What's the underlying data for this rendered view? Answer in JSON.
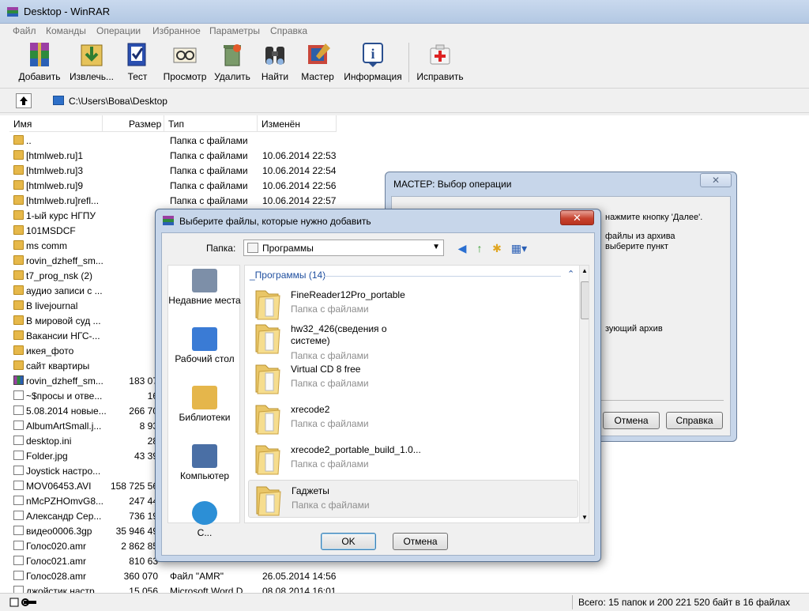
{
  "window": {
    "title": "Desktop - WinRAR"
  },
  "menu": [
    "Файл",
    "Команды",
    "Операции",
    "Избранное",
    "Параметры",
    "Справка"
  ],
  "toolbar": [
    {
      "label": "Добавить",
      "icon": "add-archive-icon"
    },
    {
      "label": "Извлечь...",
      "icon": "extract-icon"
    },
    {
      "label": "Тест",
      "icon": "test-icon"
    },
    {
      "label": "Просмотр",
      "icon": "view-icon"
    },
    {
      "label": "Удалить",
      "icon": "delete-icon"
    },
    {
      "label": "Найти",
      "icon": "find-icon"
    },
    {
      "label": "Мастер",
      "icon": "wizard-icon"
    },
    {
      "label": "Информация",
      "icon": "info-icon"
    },
    {
      "label": "Исправить",
      "icon": "repair-icon"
    }
  ],
  "address": {
    "path": "C:\\Users\\Вова\\Desktop"
  },
  "columns": {
    "name": "Имя",
    "size": "Размер",
    "type": "Тип",
    "modified": "Изменён"
  },
  "files": [
    {
      "name": "..",
      "size": "",
      "type": "Папка с файлами",
      "date": "",
      "kind": "folder"
    },
    {
      "name": "[htmlweb.ru]1",
      "size": "",
      "type": "Папка с файлами",
      "date": "10.06.2014 22:53",
      "kind": "folder"
    },
    {
      "name": "[htmlweb.ru]3",
      "size": "",
      "type": "Папка с файлами",
      "date": "10.06.2014 22:54",
      "kind": "folder"
    },
    {
      "name": "[htmlweb.ru]9",
      "size": "",
      "type": "Папка с файлами",
      "date": "10.06.2014 22:56",
      "kind": "folder"
    },
    {
      "name": "[htmlweb.ru]refl...",
      "size": "",
      "type": "Папка с файлами",
      "date": "10.06.2014 22:57",
      "kind": "folder"
    },
    {
      "name": "1-ый курс НГПУ",
      "size": "",
      "type": "",
      "date": "",
      "kind": "folder"
    },
    {
      "name": "101MSDCF",
      "size": "",
      "type": "",
      "date": "",
      "kind": "folder"
    },
    {
      "name": "ms comm",
      "size": "",
      "type": "",
      "date": "",
      "kind": "folder"
    },
    {
      "name": "rovin_dzheff_sm...",
      "size": "",
      "type": "",
      "date": "",
      "kind": "folder"
    },
    {
      "name": "t7_prog_nsk (2)",
      "size": "",
      "type": "",
      "date": "",
      "kind": "folder"
    },
    {
      "name": "аудио записи с ...",
      "size": "",
      "type": "",
      "date": "",
      "kind": "folder"
    },
    {
      "name": "В livejournal",
      "size": "",
      "type": "",
      "date": "",
      "kind": "folder"
    },
    {
      "name": "В мировой суд ...",
      "size": "",
      "type": "",
      "date": "",
      "kind": "folder"
    },
    {
      "name": "Вакансии НГС-...",
      "size": "",
      "type": "",
      "date": "",
      "kind": "folder"
    },
    {
      "name": "икея_фото",
      "size": "",
      "type": "",
      "date": "",
      "kind": "folder"
    },
    {
      "name": "сайт квартиры",
      "size": "",
      "type": "",
      "date": "",
      "kind": "folder"
    },
    {
      "name": "rovin_dzheff_sm...",
      "size": "183 07",
      "type": "",
      "date": "",
      "kind": "rar"
    },
    {
      "name": "~$просы и отве...",
      "size": "16",
      "type": "",
      "date": "",
      "kind": "file"
    },
    {
      "name": "5.08.2014 новые...",
      "size": "266 70",
      "type": "",
      "date": "",
      "kind": "file"
    },
    {
      "name": "AlbumArtSmall.j...",
      "size": "8 93",
      "type": "",
      "date": "",
      "kind": "file"
    },
    {
      "name": "desktop.ini",
      "size": "28",
      "type": "",
      "date": "",
      "kind": "file"
    },
    {
      "name": "Folder.jpg",
      "size": "43 39",
      "type": "",
      "date": "",
      "kind": "file"
    },
    {
      "name": "Joystick настро...",
      "size": "",
      "type": "",
      "date": "",
      "kind": "file"
    },
    {
      "name": "MOV06453.AVI",
      "size": "158 725 56",
      "type": "",
      "date": "",
      "kind": "file"
    },
    {
      "name": "nMcPZHOmvG8...",
      "size": "247 44",
      "type": "",
      "date": "",
      "kind": "file"
    },
    {
      "name": "Александр Сер...",
      "size": "736 19",
      "type": "",
      "date": "",
      "kind": "file"
    },
    {
      "name": "видео0006.3gp",
      "size": "35 946 49",
      "type": "",
      "date": "",
      "kind": "file"
    },
    {
      "name": "Голос020.amr",
      "size": "2 862 85",
      "type": "",
      "date": "",
      "kind": "file"
    },
    {
      "name": "Голос021.amr",
      "size": "810 63",
      "type": "",
      "date": "",
      "kind": "file"
    },
    {
      "name": "Голос028.amr",
      "size": "360 070",
      "type": "Файл \"AMR\"",
      "date": "26.05.2014 14:56",
      "kind": "file"
    },
    {
      "name": "джойстик настр...",
      "size": "15 056",
      "type": "Microsoft Word D...",
      "date": "08.08.2014 16:01",
      "kind": "file"
    }
  ],
  "status": {
    "text": "Всего: 15 папок и 200 221 520 байт в 16 файлах"
  },
  "wizard": {
    "title": "МАСТЕР:   Выбор операции",
    "close": "✕",
    "lines": [
      "нажмите кнопку 'Далее'.",
      "файлы из архива",
      "выберите пункт",
      "зующий архив"
    ],
    "cancel": "Отмена",
    "help": "Справка"
  },
  "dialog": {
    "title": "Выберите файлы, которые нужно добавить",
    "close": "✕",
    "lookin_label": "Папка:",
    "lookin_value": "Программы",
    "places": [
      {
        "label": "Недавние места",
        "icon": "recent-places-icon"
      },
      {
        "label": "Рабочий стол",
        "icon": "desktop-icon"
      },
      {
        "label": "Библиотеки",
        "icon": "libraries-icon"
      },
      {
        "label": "Компьютер",
        "icon": "computer-icon"
      },
      {
        "label": "С...",
        "icon": "network-icon"
      }
    ],
    "group": "_Программы (14)",
    "items": [
      {
        "name": "FineReader12Pro_portable",
        "type": "Папка с файлами"
      },
      {
        "name": "hw32_426(сведения о системе)",
        "type": "Папка с файлами"
      },
      {
        "name": "Virtual CD 8 free",
        "type": "Папка с файлами"
      },
      {
        "name": "xrecode2",
        "type": "Папка с файлами"
      },
      {
        "name": "xrecode2_portable_build_1.0...",
        "type": "Папка с файлами"
      },
      {
        "name": "Гаджеты",
        "type": "Папка с файлами"
      }
    ],
    "ok": "OK",
    "cancel": "Отмена"
  }
}
